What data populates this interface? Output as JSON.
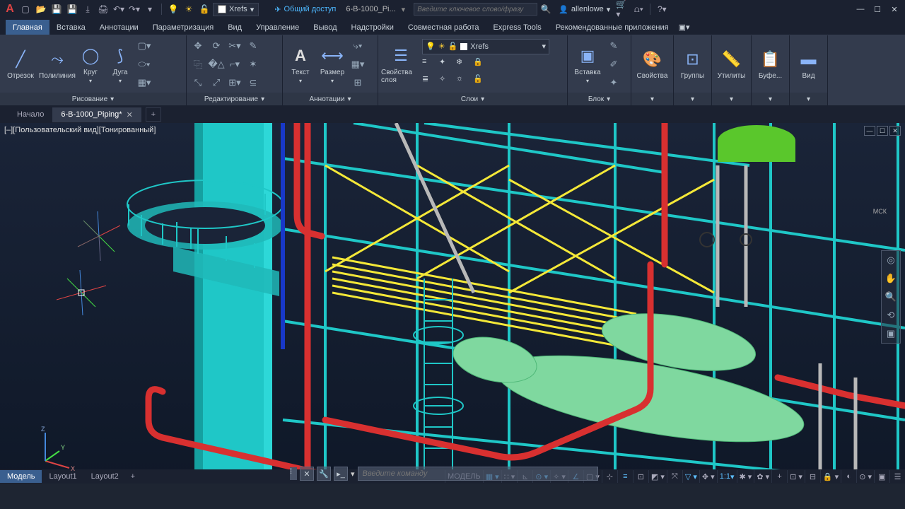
{
  "titlebar": {
    "xrefs_label": "Xrefs",
    "share": "Общий доступ",
    "doc": "6-B-1000_Pi...",
    "search_ph": "Введите ключевое слово/фразу",
    "user": "allenlowe"
  },
  "ribbon": {
    "tabs": [
      "Главная",
      "Вставка",
      "Аннотации",
      "Параметризация",
      "Вид",
      "Управление",
      "Вывод",
      "Надстройки",
      "Совместная работа",
      "Express Tools",
      "Рекомендованные приложения"
    ],
    "panels": {
      "draw": {
        "title": "Рисование",
        "line": "Отрезок",
        "polyline": "Полилиния",
        "circle": "Круг",
        "arc": "Дуга"
      },
      "modify": {
        "title": "Редактирование"
      },
      "annot": {
        "title": "Аннотации",
        "text": "Текст",
        "dim": "Размер"
      },
      "layers": {
        "title": "Слои",
        "props": "Свойства слоя",
        "combo": "Xrefs"
      },
      "block": {
        "title": "Блок",
        "insert": "Вставка"
      },
      "props": {
        "label": "Свойства"
      },
      "groups": {
        "label": "Группы"
      },
      "utils": {
        "label": "Утилиты"
      },
      "clip": {
        "label": "Буфе..."
      },
      "view": {
        "label": "Вид"
      }
    }
  },
  "doc_tabs": {
    "start": "Начало",
    "active": "6-B-1000_Piping*"
  },
  "viewport": {
    "label_view": "[Пользовательский вид]",
    "label_style": "[Тонированный]",
    "wcs": "МСК",
    "cmd_ph": "Введите команду",
    "ucs": {
      "x": "X",
      "y": "Y",
      "z": "Z"
    }
  },
  "bottom_tabs": [
    "Модель",
    "Layout1",
    "Layout2"
  ],
  "status": {
    "model": "МОДЕЛЬ",
    "scale": "1:1"
  }
}
